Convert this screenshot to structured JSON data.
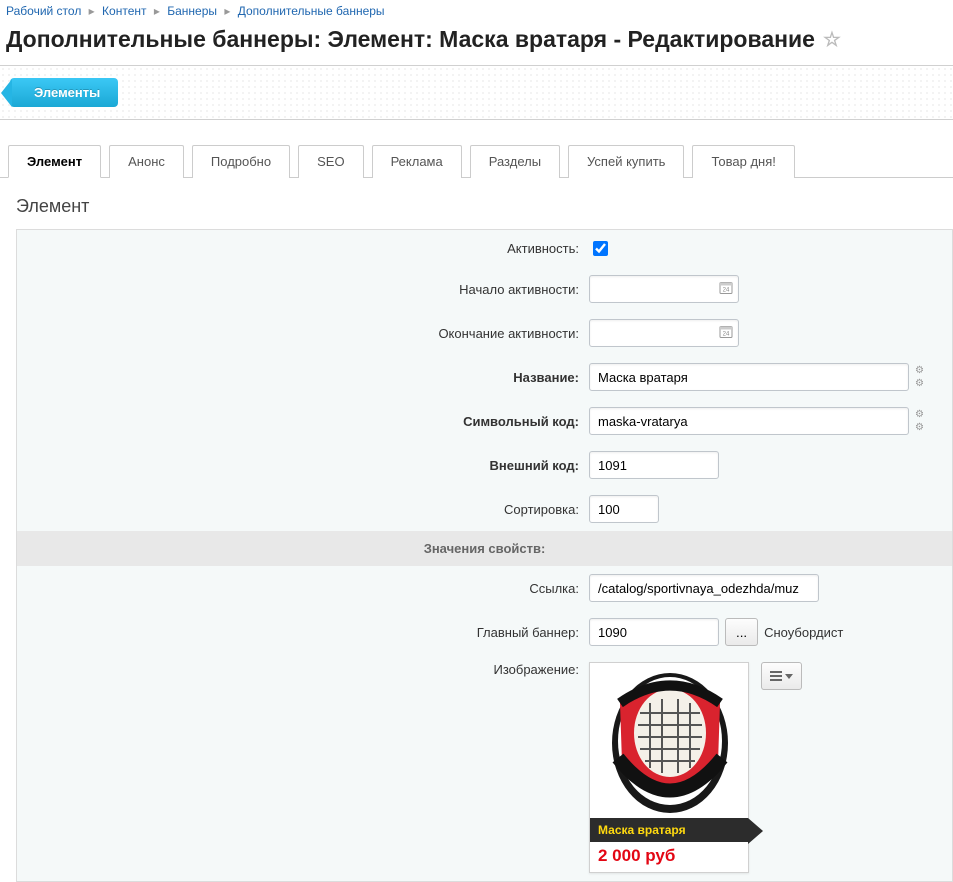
{
  "breadcrumb": {
    "items": [
      "Рабочий стол",
      "Контент",
      "Баннеры",
      "Дополнительные баннеры"
    ]
  },
  "page_title": "Дополнительные баннеры: Элемент: Маска вратаря - Редактирование",
  "toolbar": {
    "back_label": "Элементы"
  },
  "tabs": {
    "items": [
      {
        "label": "Элемент",
        "active": true
      },
      {
        "label": "Анонс"
      },
      {
        "label": "Подробно"
      },
      {
        "label": "SEO"
      },
      {
        "label": "Реклама"
      },
      {
        "label": "Разделы"
      },
      {
        "label": "Успей купить"
      },
      {
        "label": "Товар дня!"
      }
    ]
  },
  "section_title": "Элемент",
  "labels": {
    "active": "Активность:",
    "active_from": "Начало активности:",
    "active_to": "Окончание активности:",
    "name": "Название:",
    "code": "Символьный код:",
    "xml_id": "Внешний код:",
    "sort": "Сортировка:",
    "group_props": "Значения свойств:",
    "link": "Ссылка:",
    "main_banner": "Главный баннер:",
    "image": "Изображение:"
  },
  "values": {
    "active": true,
    "active_from": "",
    "active_to": "",
    "name": "Маска вратаря",
    "code": "maska-vratarya",
    "xml_id": "1091",
    "sort": "100",
    "link": "/catalog/sportivnaya_odezhda/muz",
    "main_banner_id": "1090",
    "main_banner_name": "Сноубордист"
  },
  "buttons": {
    "browse": "..."
  },
  "image_card": {
    "caption": "Маска вратаря",
    "price": "2 000 руб"
  }
}
